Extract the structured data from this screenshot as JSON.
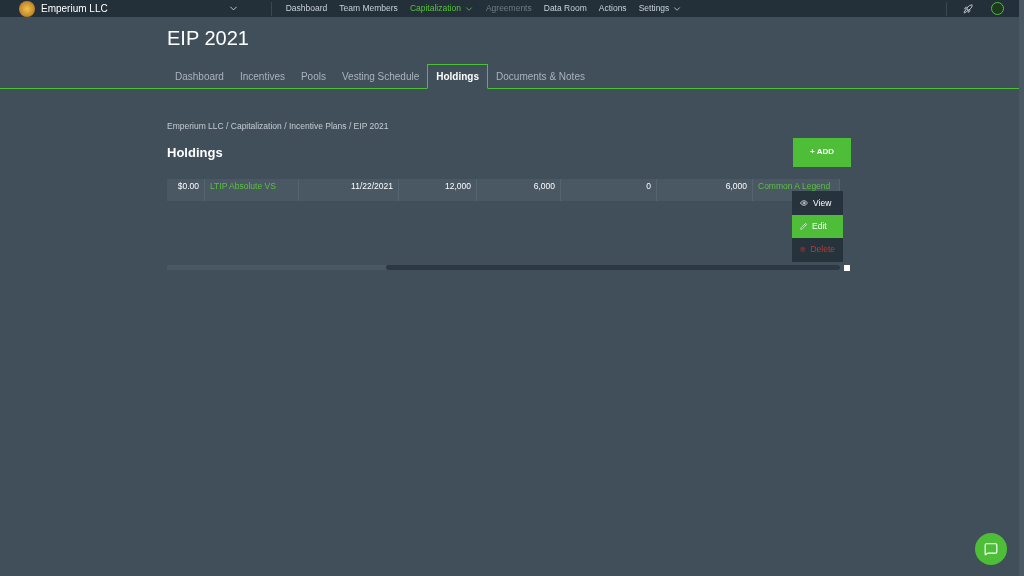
{
  "topbar": {
    "company": "Emperium LLC",
    "nav": [
      {
        "label": "Dashboard",
        "selected": false,
        "disabled": false,
        "dropdown": false
      },
      {
        "label": "Team Members",
        "selected": false,
        "disabled": false,
        "dropdown": false
      },
      {
        "label": "Capitalization",
        "selected": true,
        "disabled": false,
        "dropdown": true
      },
      {
        "label": "Agreements",
        "selected": false,
        "disabled": true,
        "dropdown": false
      },
      {
        "label": "Data Room",
        "selected": false,
        "disabled": false,
        "dropdown": false
      },
      {
        "label": "Actions",
        "selected": false,
        "disabled": false,
        "dropdown": false
      },
      {
        "label": "Settings",
        "selected": false,
        "disabled": false,
        "dropdown": true
      }
    ]
  },
  "page_title": "EIP 2021",
  "tabs": [
    {
      "label": "Dashboard",
      "selected": false
    },
    {
      "label": "Incentives",
      "selected": false
    },
    {
      "label": "Pools",
      "selected": false
    },
    {
      "label": "Vesting Schedule",
      "selected": false
    },
    {
      "label": "Holdings",
      "selected": true
    },
    {
      "label": "Documents & Notes",
      "selected": false
    }
  ],
  "breadcrumb": "Emperium LLC / Capitalization / Incentive Plans / EIP 2021",
  "section_title": "Holdings",
  "add_button": "+ ADD",
  "table": {
    "rows": [
      {
        "cells": [
          {
            "text": "$0.00",
            "kind": "plain"
          },
          {
            "text": "LTIP Absolute VS",
            "kind": "link"
          },
          {
            "text": "11/22/2021",
            "kind": "plain"
          },
          {
            "text": "12,000",
            "kind": "plain"
          },
          {
            "text": "6,000",
            "kind": "plain"
          },
          {
            "text": "0",
            "kind": "plain"
          },
          {
            "text": "6,000",
            "kind": "plain"
          },
          {
            "text": "Common A Legend",
            "kind": "link"
          }
        ]
      }
    ]
  },
  "row_menu": [
    {
      "label": "View",
      "kind": "view",
      "selected": false
    },
    {
      "label": "Edit",
      "kind": "edit",
      "selected": true
    },
    {
      "label": "Delete",
      "kind": "delete",
      "selected": false
    }
  ]
}
